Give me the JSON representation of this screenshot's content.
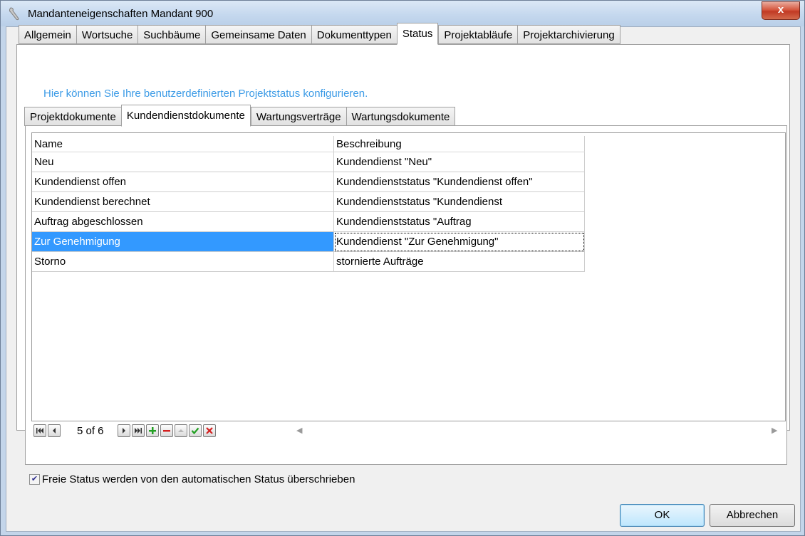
{
  "window": {
    "title": "Mandanteneigenschaften Mandant 900",
    "close_label": "x"
  },
  "main_tabs": [
    {
      "label": "Allgemein",
      "active": false
    },
    {
      "label": "Wortsuche",
      "active": false
    },
    {
      "label": "Suchbäume",
      "active": false
    },
    {
      "label": "Gemeinsame Daten",
      "active": false
    },
    {
      "label": "Dokumenttypen",
      "active": false
    },
    {
      "label": "Status",
      "active": true
    },
    {
      "label": "Projektabläufe",
      "active": false
    },
    {
      "label": "Projektarchivierung",
      "active": false
    }
  ],
  "hint_text": "Hier können Sie Ihre benutzerdefinierten Projektstatus konfigurieren.",
  "sub_tabs": [
    {
      "label": "Projektdokumente",
      "active": false
    },
    {
      "label": "Kundendienstdokumente",
      "active": true
    },
    {
      "label": "Wartungsverträge",
      "active": false
    },
    {
      "label": "Wartungsdokumente",
      "active": false
    }
  ],
  "table": {
    "columns": [
      "Name",
      "Beschreibung"
    ],
    "rows": [
      {
        "name": "Neu",
        "description": "Kundendienst \"Neu\""
      },
      {
        "name": "Kundendienst offen",
        "description": "Kundendienststatus \"Kundendienst offen\""
      },
      {
        "name": "Kundendienst berechnet",
        "description": "Kundendienststatus \"Kundendienst"
      },
      {
        "name": "Auftrag abgeschlossen",
        "description": "Kundendienststatus \"Auftrag"
      },
      {
        "name": "Zur Genehmigung",
        "description": "Kundendienst \"Zur Genehmigung\""
      },
      {
        "name": "Storno",
        "description": "stornierte Aufträge"
      }
    ],
    "selected_row": 4
  },
  "navigator": {
    "position": "5 of 6",
    "icons": [
      "first-icon",
      "prev-icon",
      "next-icon",
      "last-icon",
      "add-icon",
      "delete-icon",
      "move-up-icon",
      "confirm-icon",
      "cancel-icon"
    ]
  },
  "checkbox": {
    "label": "Freie Status werden von den automatischen Status überschrieben",
    "checked": true
  },
  "buttons": {
    "ok": "OK",
    "cancel": "Abbrechen"
  },
  "colors": {
    "selection": "#3399ff",
    "hint": "#3c9be6"
  }
}
